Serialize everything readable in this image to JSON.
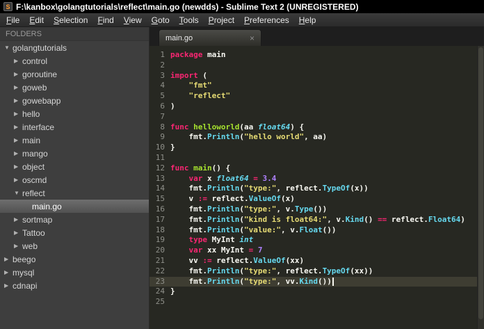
{
  "window": {
    "title": "F:\\kanbox\\golangtutorials\\reflect\\main.go (newdds) - Sublime Text 2 (UNREGISTERED)",
    "app_icon_letter": "S"
  },
  "menu": {
    "items": [
      "File",
      "Edit",
      "Selection",
      "Find",
      "View",
      "Goto",
      "Tools",
      "Project",
      "Preferences",
      "Help"
    ]
  },
  "sidebar": {
    "header": "FOLDERS",
    "items": [
      {
        "label": "golangtutorials",
        "level": 0,
        "state": "expanded",
        "type": "folder",
        "selected": false
      },
      {
        "label": "control",
        "level": 1,
        "state": "collapsed",
        "type": "folder",
        "selected": false
      },
      {
        "label": "goroutine",
        "level": 1,
        "state": "collapsed",
        "type": "folder",
        "selected": false
      },
      {
        "label": "goweb",
        "level": 1,
        "state": "collapsed",
        "type": "folder",
        "selected": false
      },
      {
        "label": "gowebapp",
        "level": 1,
        "state": "collapsed",
        "type": "folder",
        "selected": false
      },
      {
        "label": "hello",
        "level": 1,
        "state": "collapsed",
        "type": "folder",
        "selected": false
      },
      {
        "label": "interface",
        "level": 1,
        "state": "collapsed",
        "type": "folder",
        "selected": false
      },
      {
        "label": "main",
        "level": 1,
        "state": "collapsed",
        "type": "folder",
        "selected": false
      },
      {
        "label": "mango",
        "level": 1,
        "state": "collapsed",
        "type": "folder",
        "selected": false
      },
      {
        "label": "object",
        "level": 1,
        "state": "collapsed",
        "type": "folder",
        "selected": false
      },
      {
        "label": "oscmd",
        "level": 1,
        "state": "collapsed",
        "type": "folder",
        "selected": false
      },
      {
        "label": "reflect",
        "level": 1,
        "state": "expanded",
        "type": "folder",
        "selected": false
      },
      {
        "label": "main.go",
        "level": 2,
        "state": "none",
        "type": "file",
        "selected": true
      },
      {
        "label": "sortmap",
        "level": 1,
        "state": "collapsed",
        "type": "folder",
        "selected": false
      },
      {
        "label": "Tattoo",
        "level": 1,
        "state": "collapsed",
        "type": "folder",
        "selected": false
      },
      {
        "label": "web",
        "level": 1,
        "state": "collapsed",
        "type": "folder",
        "selected": false
      },
      {
        "label": "beego",
        "level": 0,
        "state": "collapsed",
        "type": "folder",
        "selected": false
      },
      {
        "label": "mysql",
        "level": 0,
        "state": "collapsed",
        "type": "folder",
        "selected": false
      },
      {
        "label": "cdnapi",
        "level": 0,
        "state": "collapsed",
        "type": "folder",
        "selected": false
      }
    ]
  },
  "tabs": [
    {
      "label": "main.go",
      "active": true,
      "close_glyph": "×"
    }
  ],
  "editor": {
    "language": "go",
    "current_line": 23,
    "cursor_line": 23,
    "lines": [
      {
        "n": 1,
        "tokens": [
          [
            "kw",
            "package"
          ],
          [
            "pl",
            " main"
          ]
        ]
      },
      {
        "n": 2,
        "tokens": []
      },
      {
        "n": 3,
        "tokens": [
          [
            "kw",
            "import"
          ],
          [
            "pl",
            " ("
          ]
        ]
      },
      {
        "n": 4,
        "tokens": [
          [
            "pl",
            "    "
          ],
          [
            "str",
            "\"fmt\""
          ]
        ]
      },
      {
        "n": 5,
        "tokens": [
          [
            "pl",
            "    "
          ],
          [
            "str",
            "\"reflect\""
          ]
        ]
      },
      {
        "n": 6,
        "tokens": [
          [
            "pl",
            ")"
          ]
        ]
      },
      {
        "n": 7,
        "tokens": []
      },
      {
        "n": 8,
        "tokens": [
          [
            "kw",
            "func"
          ],
          [
            "pl",
            " "
          ],
          [
            "fnd",
            "helloworld"
          ],
          [
            "pl",
            "(aa "
          ],
          [
            "typ",
            "float64"
          ],
          [
            "pl",
            ") {"
          ]
        ]
      },
      {
        "n": 9,
        "tokens": [
          [
            "pl",
            "    fmt."
          ],
          [
            "fnc",
            "Println"
          ],
          [
            "pl",
            "("
          ],
          [
            "str",
            "\"hello world\""
          ],
          [
            "pl",
            ", aa)"
          ]
        ]
      },
      {
        "n": 10,
        "tokens": [
          [
            "pl",
            "}"
          ]
        ]
      },
      {
        "n": 11,
        "tokens": []
      },
      {
        "n": 12,
        "tokens": [
          [
            "kw",
            "func"
          ],
          [
            "pl",
            " "
          ],
          [
            "fnd",
            "main"
          ],
          [
            "pl",
            "() {"
          ]
        ]
      },
      {
        "n": 13,
        "tokens": [
          [
            "pl",
            "    "
          ],
          [
            "kw",
            "var"
          ],
          [
            "pl",
            " x "
          ],
          [
            "typ",
            "float64"
          ],
          [
            "pl",
            " "
          ],
          [
            "kw",
            "="
          ],
          [
            "pl",
            " "
          ],
          [
            "num",
            "3.4"
          ]
        ]
      },
      {
        "n": 14,
        "tokens": [
          [
            "pl",
            "    fmt."
          ],
          [
            "fnc",
            "Println"
          ],
          [
            "pl",
            "("
          ],
          [
            "str",
            "\"type:\""
          ],
          [
            "pl",
            ", reflect."
          ],
          [
            "fnc",
            "TypeOf"
          ],
          [
            "pl",
            "(x))"
          ]
        ]
      },
      {
        "n": 15,
        "tokens": [
          [
            "pl",
            "    v "
          ],
          [
            "kw",
            ":="
          ],
          [
            "pl",
            " reflect."
          ],
          [
            "fnc",
            "ValueOf"
          ],
          [
            "pl",
            "(x)"
          ]
        ]
      },
      {
        "n": 16,
        "tokens": [
          [
            "pl",
            "    fmt."
          ],
          [
            "fnc",
            "Println"
          ],
          [
            "pl",
            "("
          ],
          [
            "str",
            "\"type:\""
          ],
          [
            "pl",
            ", v."
          ],
          [
            "fnc",
            "Type"
          ],
          [
            "pl",
            "())"
          ]
        ]
      },
      {
        "n": 17,
        "tokens": [
          [
            "pl",
            "    fmt."
          ],
          [
            "fnc",
            "Println"
          ],
          [
            "pl",
            "("
          ],
          [
            "str",
            "\"kind is float64:\""
          ],
          [
            "pl",
            ", v."
          ],
          [
            "fnc",
            "Kind"
          ],
          [
            "pl",
            "() "
          ],
          [
            "kw",
            "=="
          ],
          [
            "pl",
            " reflect."
          ],
          [
            "fnc",
            "Float64"
          ],
          [
            "pl",
            ")"
          ]
        ]
      },
      {
        "n": 18,
        "tokens": [
          [
            "pl",
            "    fmt."
          ],
          [
            "fnc",
            "Println"
          ],
          [
            "pl",
            "("
          ],
          [
            "str",
            "\"value:\""
          ],
          [
            "pl",
            ", v."
          ],
          [
            "fnc",
            "Float"
          ],
          [
            "pl",
            "())"
          ]
        ]
      },
      {
        "n": 19,
        "tokens": [
          [
            "pl",
            "    "
          ],
          [
            "kw",
            "type"
          ],
          [
            "pl",
            " MyInt "
          ],
          [
            "typ",
            "int"
          ]
        ]
      },
      {
        "n": 20,
        "tokens": [
          [
            "pl",
            "    "
          ],
          [
            "kw",
            "var"
          ],
          [
            "pl",
            " xx MyInt "
          ],
          [
            "kw",
            "="
          ],
          [
            "pl",
            " "
          ],
          [
            "num",
            "7"
          ]
        ]
      },
      {
        "n": 21,
        "tokens": [
          [
            "pl",
            "    vv "
          ],
          [
            "kw",
            ":="
          ],
          [
            "pl",
            " reflect."
          ],
          [
            "fnc",
            "ValueOf"
          ],
          [
            "pl",
            "(xx)"
          ]
        ]
      },
      {
        "n": 22,
        "tokens": [
          [
            "pl",
            "    fmt."
          ],
          [
            "fnc",
            "Println"
          ],
          [
            "pl",
            "("
          ],
          [
            "str",
            "\"type:\""
          ],
          [
            "pl",
            ", reflect."
          ],
          [
            "fnc",
            "TypeOf"
          ],
          [
            "pl",
            "(xx))"
          ]
        ]
      },
      {
        "n": 23,
        "tokens": [
          [
            "pl",
            "    fmt."
          ],
          [
            "fnc",
            "Println"
          ],
          [
            "pl",
            "("
          ],
          [
            "str",
            "\"type:\""
          ],
          [
            "pl",
            ", vv."
          ],
          [
            "fnc",
            "Kind"
          ],
          [
            "pl",
            "())"
          ]
        ]
      },
      {
        "n": 24,
        "tokens": [
          [
            "pl",
            "}"
          ]
        ]
      },
      {
        "n": 25,
        "tokens": []
      }
    ]
  },
  "colors": {
    "editor_bg": "#272822",
    "current_line_bg": "#3e3d32",
    "keyword": "#f92672",
    "type_italic": "#66d9ef",
    "function_call": "#66d9ef",
    "function_def": "#a6e22e",
    "string": "#e6db74",
    "number": "#ae81ff",
    "plain": "#f8f8f2",
    "gutter": "#8f908a",
    "sidebar_bg": "#3e3e3e"
  }
}
